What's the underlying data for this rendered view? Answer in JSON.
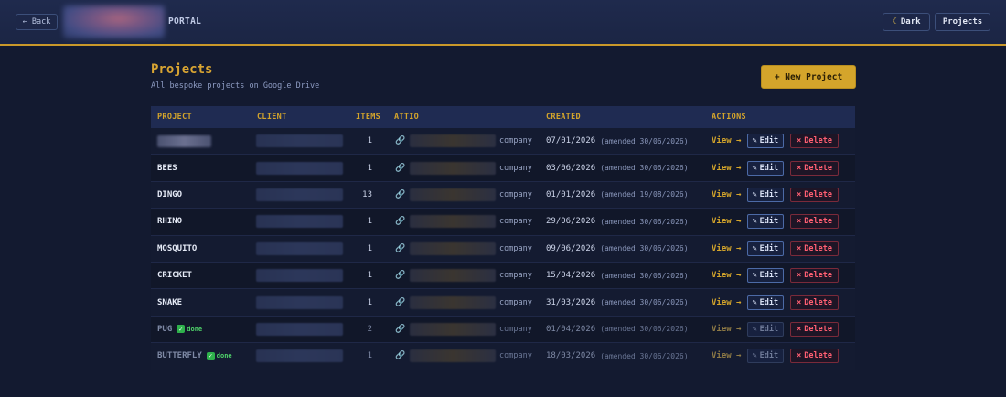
{
  "header": {
    "back_label": "← Back",
    "portal_label": "PORTAL",
    "dark_toggle_label": "Dark",
    "projects_label": "Projects"
  },
  "page": {
    "title": "Projects",
    "subtitle": "All bespoke projects on Google Drive",
    "new_project_label": "+ New Project"
  },
  "table": {
    "columns": [
      "PROJECT",
      "CLIENT",
      "ITEMS",
      "ATTIO",
      "CREATED",
      "ACTIONS"
    ],
    "view_label": "View →",
    "edit_label": "Edit",
    "delete_label": "Delete",
    "done_label": "done",
    "rows": [
      {
        "name": "",
        "name_redacted": true,
        "items": "1",
        "attio_type": "company",
        "created": "07/01/2026",
        "amended": "(amended 30/06/2026)",
        "done": false
      },
      {
        "name": "BEES",
        "items": "1",
        "attio_type": "company",
        "created": "03/06/2026",
        "amended": "(amended 30/06/2026)",
        "done": false
      },
      {
        "name": "DINGO",
        "items": "13",
        "attio_type": "company",
        "created": "01/01/2026",
        "amended": "(amended 19/08/2026)",
        "done": false
      },
      {
        "name": "RHINO",
        "items": "1",
        "attio_type": "company",
        "created": "29/06/2026",
        "amended": "(amended 30/06/2026)",
        "done": false
      },
      {
        "name": "MOSQUITO",
        "items": "1",
        "attio_type": "company",
        "created": "09/06/2026",
        "amended": "(amended 30/06/2026)",
        "done": false
      },
      {
        "name": "CRICKET",
        "items": "1",
        "attio_type": "company",
        "created": "15/04/2026",
        "amended": "(amended 30/06/2026)",
        "done": false
      },
      {
        "name": "SNAKE",
        "items": "1",
        "attio_type": "company",
        "created": "31/03/2026",
        "amended": "(amended 30/06/2026)",
        "done": false
      },
      {
        "name": "PUG",
        "items": "2",
        "attio_type": "company",
        "created": "01/04/2026",
        "amended": "(amended 30/06/2026)",
        "done": true
      },
      {
        "name": "BUTTERFLY",
        "items": "1",
        "attio_type": "company",
        "created": "18/03/2026",
        "amended": "(amended 30/06/2026)",
        "done": true
      }
    ]
  },
  "icons": {
    "back": "arrow-left-icon",
    "dark": "moon-icon",
    "link": "link-icon",
    "edit": "pencil-icon",
    "delete": "x-icon",
    "done": "check-icon"
  },
  "colors": {
    "accent": "#d4a52b",
    "background": "#131a30",
    "header": "#1f2a4d",
    "danger": "#ff5f72",
    "success": "#4fd36a"
  }
}
